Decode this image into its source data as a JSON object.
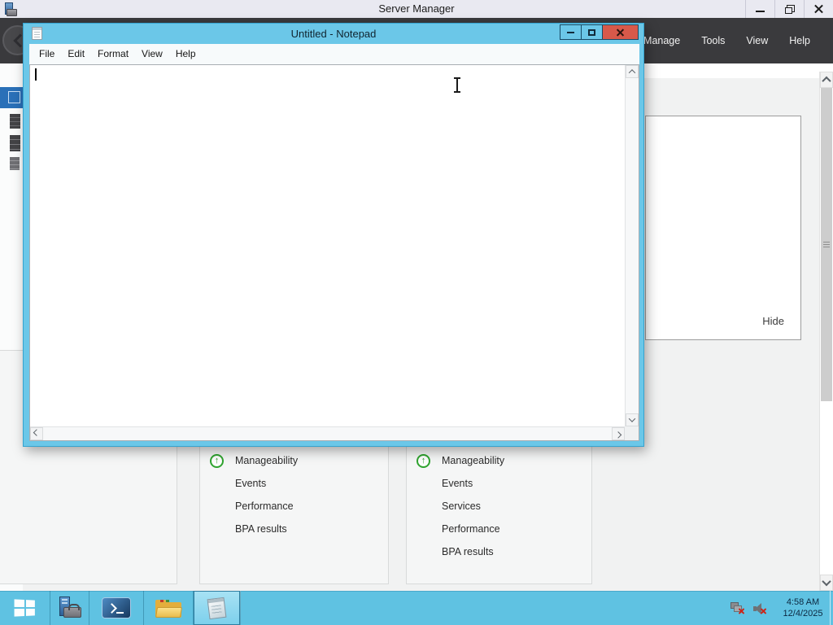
{
  "server_manager": {
    "title": "Server Manager",
    "nav_menu": [
      {
        "label": "Manage"
      },
      {
        "label": "Tools"
      },
      {
        "label": "View"
      },
      {
        "label": "Help"
      }
    ],
    "dashboard": {
      "tiles": [
        {
          "rows": [
            {
              "label": "Manageability",
              "status_icon": "green-up-arrow"
            },
            {
              "label": "Events"
            },
            {
              "label": "Performance"
            },
            {
              "label": "BPA results"
            }
          ]
        },
        {
          "rows": [
            {
              "label": "Manageability",
              "status_icon": "green-up-arrow"
            },
            {
              "label": "Events"
            },
            {
              "label": "Services"
            },
            {
              "label": "Performance"
            },
            {
              "label": "BPA results"
            }
          ]
        }
      ],
      "hide_label": "Hide"
    }
  },
  "notepad": {
    "title": "Untitled - Notepad",
    "menu": [
      {
        "label": "File"
      },
      {
        "label": "Edit"
      },
      {
        "label": "Format"
      },
      {
        "label": "View"
      },
      {
        "label": "Help"
      }
    ],
    "editor_content": ""
  },
  "taskbar": {
    "buttons": [
      {
        "icon": "windows-logo-icon"
      },
      {
        "icon": "server-manager-icon"
      },
      {
        "icon": "powershell-icon"
      },
      {
        "icon": "folder-icon"
      },
      {
        "icon": "notepad-icon",
        "active": true
      }
    ],
    "tray_icons": [
      "network-disconnected-icon",
      "volume-muted-icon"
    ],
    "clock": {
      "time": "4:58 AM",
      "date": "12/4/2025"
    }
  },
  "colors": {
    "taskbar_blue": "#5FC2E2",
    "notepad_chrome": "#6BC7E8",
    "close_red": "#D7594A",
    "status_green": "#2FA42F",
    "dark_band": "#3A3A3D",
    "sidebar_selected_blue": "#2A70B8"
  }
}
